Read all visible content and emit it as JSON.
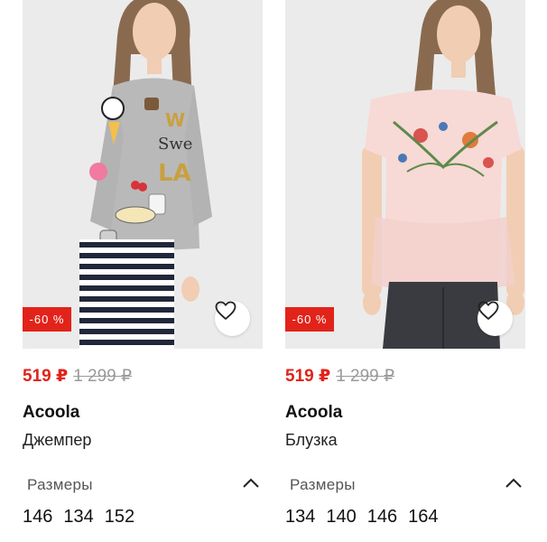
{
  "theme": {
    "sale_color": "#e2231a",
    "text": "#111111",
    "muted": "#9a9a9a"
  },
  "products": [
    {
      "discount": "-60 %",
      "price_new": "519 ₽",
      "price_old": "1 299 ₽",
      "brand": "Acoola",
      "type": "Джемпер",
      "sizes_label": "Размеры",
      "sizes": [
        "146",
        "134",
        "152"
      ]
    },
    {
      "discount": "-60 %",
      "price_new": "519 ₽",
      "price_old": "1 299 ₽",
      "brand": "Acoola",
      "type": "Блузка",
      "sizes_label": "Размеры",
      "sizes": [
        "134",
        "140",
        "146",
        "164"
      ]
    }
  ],
  "icons": {
    "favorite": "heart-icon",
    "collapse": "chevron-up-icon"
  }
}
